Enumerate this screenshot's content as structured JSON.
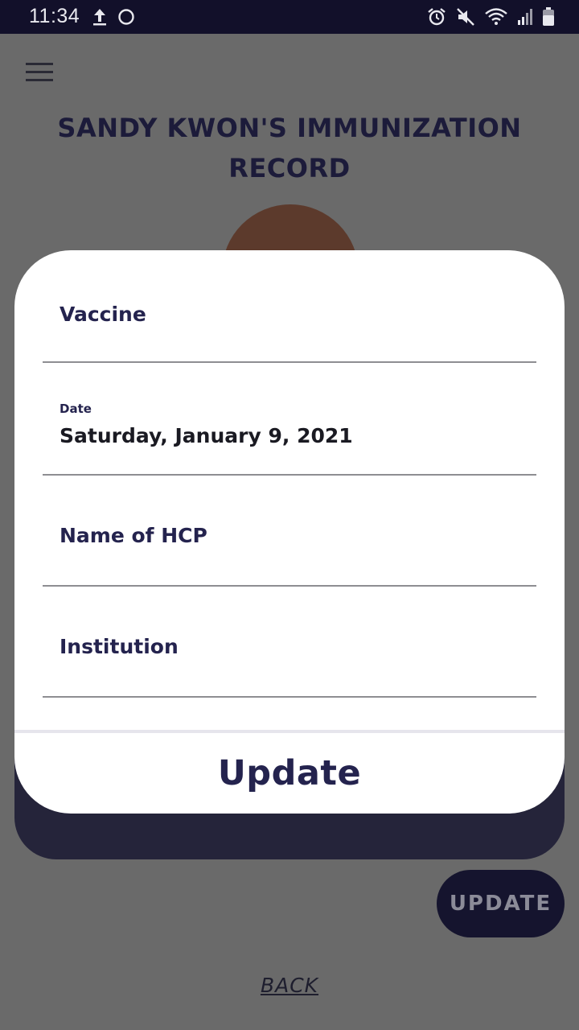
{
  "status_bar": {
    "time": "11:34",
    "left_icons": [
      "upload-icon",
      "circle-icon"
    ],
    "right_icons": [
      "alarm-icon",
      "mute-icon",
      "wifi-icon",
      "signal-icon",
      "battery-icon"
    ]
  },
  "page": {
    "title": "SANDY KWON'S IMMUNIZATION RECORD",
    "update_label": "UPDATE",
    "back_label": "BACK"
  },
  "modal": {
    "fields": {
      "vaccine": {
        "label": "Vaccine"
      },
      "date": {
        "label": "Date",
        "value": "Saturday, January 9, 2021"
      },
      "hcp": {
        "label": "Name of HCP"
      },
      "institution": {
        "label": "Institution"
      }
    },
    "update_label": "Update"
  },
  "colors": {
    "accent": "#24234e",
    "status_bar": "#12102a",
    "overlay": "#6a6a6a"
  }
}
